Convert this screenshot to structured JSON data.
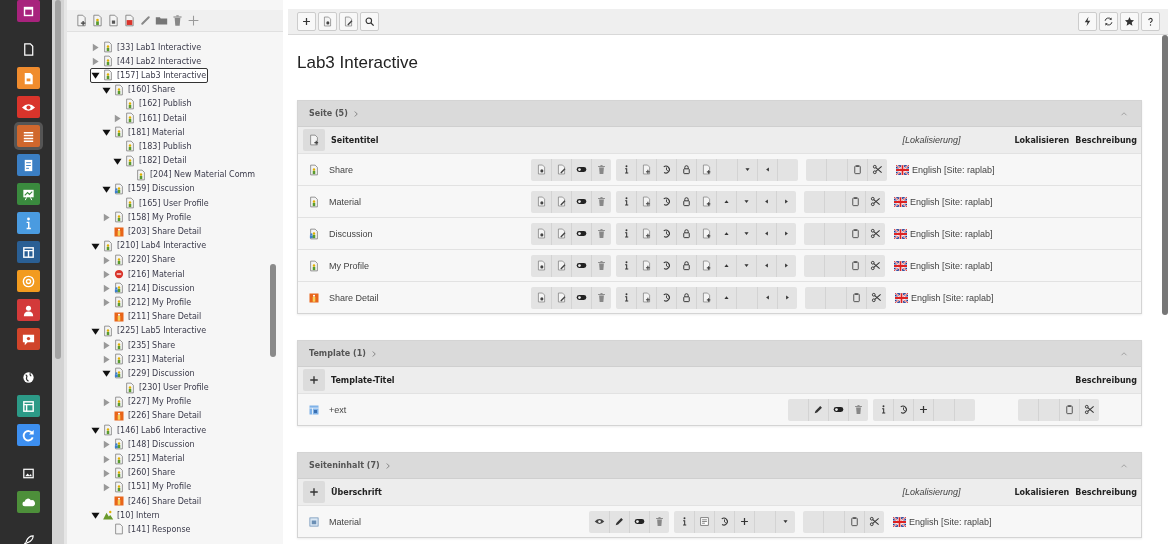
{
  "modules": [
    {
      "kind": "tile",
      "color": "#a8237d",
      "selected": false
    },
    {
      "kind": "plain",
      "selected": false
    },
    {
      "kind": "tile",
      "color": "#f08c2e",
      "selected": false
    },
    {
      "kind": "tile",
      "color": "#d9342b",
      "selected": false
    },
    {
      "kind": "tile",
      "color": "#d0672d",
      "selected": true
    },
    {
      "kind": "tile",
      "color": "#3b7fc4",
      "selected": false
    },
    {
      "kind": "tile",
      "color": "#3a8a3e",
      "selected": false
    },
    {
      "kind": "tile",
      "color": "#4a9be0",
      "selected": false
    },
    {
      "kind": "tile",
      "color": "#2a5f94",
      "selected": false
    },
    {
      "kind": "tile",
      "color": "#f29b1f",
      "selected": false
    },
    {
      "kind": "tile",
      "color": "#d33a3a",
      "selected": false
    },
    {
      "kind": "tile",
      "color": "#d0442a",
      "selected": false
    },
    {
      "kind": "plain",
      "selected": false
    },
    {
      "kind": "tile",
      "color": "#2c9a87",
      "selected": false
    },
    {
      "kind": "tile",
      "color": "#3d8ff0",
      "selected": false
    },
    {
      "kind": "plain",
      "selected": false
    },
    {
      "kind": "tile",
      "color": "#4d8f3a",
      "selected": false
    },
    {
      "kind": "plain",
      "selected": false
    }
  ],
  "tree": {
    "items": [
      {
        "label": "[33] Lab1 Interactive",
        "kind": "page",
        "expanded": false,
        "selected": false
      },
      {
        "label": "[44] Lab2 Interactive",
        "kind": "page",
        "expanded": false,
        "selected": false
      },
      {
        "label": "[157] Lab3 Interactive",
        "kind": "page",
        "expanded": true,
        "selected": true,
        "children": [
          {
            "label": "[160] Share",
            "kind": "page",
            "expanded": true,
            "selected": false,
            "children": [
              {
                "label": "[162] Publish",
                "kind": "page",
                "selected": false
              },
              {
                "label": "[161] Detail",
                "kind": "page",
                "expanded": false,
                "selected": false
              }
            ]
          },
          {
            "label": "[181] Material",
            "kind": "page",
            "expanded": true,
            "selected": false,
            "children": [
              {
                "label": "[183] Publish",
                "kind": "page",
                "selected": false
              },
              {
                "label": "[182] Detail",
                "kind": "page",
                "expanded": true,
                "selected": false,
                "children": [
                  {
                    "label": "[204] New Material Comm",
                    "kind": "page",
                    "selected": false
                  }
                ]
              }
            ]
          },
          {
            "label": "[159] Discussion",
            "kind": "group",
            "expanded": true,
            "selected": false,
            "children": [
              {
                "label": "[165] User Profile",
                "kind": "page",
                "selected": false
              }
            ]
          },
          {
            "label": "[158] My Profile",
            "kind": "page",
            "expanded": false,
            "selected": false
          },
          {
            "label": "[203] Share Detail",
            "kind": "shortcut",
            "selected": false
          }
        ]
      },
      {
        "label": "[210] Lab4 Interactive",
        "kind": "page",
        "expanded": true,
        "selected": false,
        "children": [
          {
            "label": "[220] Share",
            "kind": "page",
            "expanded": false,
            "selected": false
          },
          {
            "label": "[216] Material",
            "kind": "hidden",
            "expanded": false,
            "selected": false
          },
          {
            "label": "[214] Discussion",
            "kind": "group",
            "expanded": false,
            "selected": false
          },
          {
            "label": "[212] My Profile",
            "kind": "page",
            "expanded": false,
            "selected": false
          },
          {
            "label": "[211] Share Detail",
            "kind": "shortcut",
            "selected": false
          }
        ]
      },
      {
        "label": "[225] Lab5 Interactive",
        "kind": "page",
        "expanded": true,
        "selected": false,
        "children": [
          {
            "label": "[235] Share",
            "kind": "page",
            "expanded": false,
            "selected": false
          },
          {
            "label": "[231] Material",
            "kind": "page",
            "expanded": false,
            "selected": false
          },
          {
            "label": "[229] Discussion",
            "kind": "group",
            "expanded": true,
            "selected": false,
            "children": [
              {
                "label": "[230] User Profile",
                "kind": "page",
                "selected": false
              }
            ]
          },
          {
            "label": "[227] My Profile",
            "kind": "page",
            "expanded": false,
            "selected": false
          },
          {
            "label": "[226] Share Detail",
            "kind": "shortcut",
            "selected": false
          }
        ]
      },
      {
        "label": "[146] Lab6 Interactive",
        "kind": "page",
        "expanded": true,
        "selected": false,
        "children": [
          {
            "label": "[148] Discussion",
            "kind": "group",
            "expanded": false,
            "selected": false
          },
          {
            "label": "[251] Material",
            "kind": "page",
            "expanded": false,
            "selected": false
          },
          {
            "label": "[260] Share",
            "kind": "page",
            "expanded": false,
            "selected": false
          },
          {
            "label": "[151] My Profile",
            "kind": "page",
            "expanded": false,
            "selected": false
          },
          {
            "label": "[246] Share Detail",
            "kind": "shortcut",
            "selected": false
          }
        ]
      },
      {
        "label": "[10] Intern",
        "kind": "folder",
        "expanded": true,
        "selected": false,
        "children": [
          {
            "label": "[141] Response",
            "kind": "plain",
            "selected": false
          }
        ]
      }
    ]
  },
  "page_title": "Lab3 Interactive",
  "panels": [
    {
      "title": "Seite (5)",
      "header": {
        "button": {
          "kind": "page-add"
        },
        "title": "Seitentitel",
        "localization": "[Lokalisierung]",
        "localize": "Lokalisieren",
        "description": "Beschreibung"
      },
      "rows": [
        {
          "kind": "page",
          "title": "Share",
          "actions": [
            [
              {
                "kind": "page-view"
              },
              {
                "kind": "page-edit"
              },
              {
                "kind": "toggle"
              },
              {
                "kind": "delete"
              }
            ],
            [
              {
                "kind": "info"
              },
              {
                "kind": "page-new"
              },
              {
                "kind": "history"
              },
              {
                "kind": "lock"
              },
              {
                "kind": "page-add"
              },
              {
                "kind": "blank"
              },
              {
                "kind": "down"
              },
              {
                "kind": "left"
              },
              {
                "kind": "blank"
              }
            ],
            [
              {
                "kind": "blank"
              },
              {
                "kind": "blank"
              },
              {
                "kind": "paste"
              },
              {
                "kind": "cut"
              }
            ]
          ],
          "language": "English [Site: raplab]"
        },
        {
          "kind": "page",
          "title": "Material",
          "actions": [
            [
              {
                "kind": "page-view"
              },
              {
                "kind": "page-edit"
              },
              {
                "kind": "toggle"
              },
              {
                "kind": "delete"
              }
            ],
            [
              {
                "kind": "info"
              },
              {
                "kind": "page-new"
              },
              {
                "kind": "history"
              },
              {
                "kind": "lock"
              },
              {
                "kind": "page-add"
              },
              {
                "kind": "up"
              },
              {
                "kind": "down"
              },
              {
                "kind": "left"
              },
              {
                "kind": "right"
              }
            ],
            [
              {
                "kind": "blank"
              },
              {
                "kind": "blank"
              },
              {
                "kind": "paste"
              },
              {
                "kind": "cut"
              }
            ]
          ],
          "language": "English [Site: raplab]"
        },
        {
          "kind": "group",
          "title": "Discussion",
          "actions": [
            [
              {
                "kind": "page-view"
              },
              {
                "kind": "page-edit"
              },
              {
                "kind": "toggle"
              },
              {
                "kind": "delete"
              }
            ],
            [
              {
                "kind": "info"
              },
              {
                "kind": "page-new"
              },
              {
                "kind": "history"
              },
              {
                "kind": "lock"
              },
              {
                "kind": "page-add"
              },
              {
                "kind": "up"
              },
              {
                "kind": "down"
              },
              {
                "kind": "left"
              },
              {
                "kind": "right"
              }
            ],
            [
              {
                "kind": "blank"
              },
              {
                "kind": "blank"
              },
              {
                "kind": "paste"
              },
              {
                "kind": "cut"
              }
            ]
          ],
          "language": "English [Site: raplab]"
        },
        {
          "kind": "page",
          "title": "My Profile",
          "actions": [
            [
              {
                "kind": "page-view"
              },
              {
                "kind": "page-edit"
              },
              {
                "kind": "toggle"
              },
              {
                "kind": "delete"
              }
            ],
            [
              {
                "kind": "info"
              },
              {
                "kind": "page-new"
              },
              {
                "kind": "history"
              },
              {
                "kind": "lock"
              },
              {
                "kind": "page-add"
              },
              {
                "kind": "up"
              },
              {
                "kind": "down"
              },
              {
                "kind": "left"
              },
              {
                "kind": "right"
              }
            ],
            [
              {
                "kind": "blank"
              },
              {
                "kind": "blank"
              },
              {
                "kind": "paste"
              },
              {
                "kind": "cut"
              }
            ]
          ],
          "language": "English [Site: raplab]"
        },
        {
          "kind": "shortcut",
          "title": "Share Detail",
          "actions": [
            [
              {
                "kind": "page-view"
              },
              {
                "kind": "page-edit"
              },
              {
                "kind": "toggle"
              },
              {
                "kind": "delete"
              }
            ],
            [
              {
                "kind": "info"
              },
              {
                "kind": "page-new"
              },
              {
                "kind": "history"
              },
              {
                "kind": "lock"
              },
              {
                "kind": "page-add"
              },
              {
                "kind": "up"
              },
              {
                "kind": "blank"
              },
              {
                "kind": "left"
              },
              {
                "kind": "right"
              }
            ],
            [
              {
                "kind": "blank"
              },
              {
                "kind": "blank"
              },
              {
                "kind": "paste"
              },
              {
                "kind": "cut"
              }
            ]
          ],
          "language": "English [Site: raplab]"
        }
      ]
    },
    {
      "title": "Template (1)",
      "header": {
        "button": {
          "kind": "plus"
        },
        "title": "Template-Titel",
        "description": "Beschreibung"
      },
      "rows": [
        {
          "kind": "template",
          "title": "+ext",
          "actions": [
            [
              {
                "kind": "blank"
              },
              {
                "kind": "edit"
              },
              {
                "kind": "toggle"
              },
              {
                "kind": "delete"
              }
            ],
            [
              {
                "kind": "info"
              },
              {
                "kind": "history"
              },
              {
                "kind": "plus"
              },
              {
                "kind": "blank"
              },
              {
                "kind": "blank"
              }
            ],
            [
              {
                "kind": "blank"
              },
              {
                "kind": "blank"
              },
              {
                "kind": "paste"
              },
              {
                "kind": "cut"
              }
            ]
          ]
        }
      ]
    },
    {
      "title": "Seiteninhalt (7)",
      "header": {
        "button": {
          "kind": "plus"
        },
        "title": "Überschrift",
        "localization": "[Lokalisierung]",
        "localize": "Lokalisieren",
        "description": "Beschreibung"
      },
      "rows": [
        {
          "kind": "content",
          "title": "Material",
          "actions": [
            [
              {
                "kind": "eye"
              },
              {
                "kind": "edit"
              },
              {
                "kind": "toggle"
              },
              {
                "kind": "delete"
              }
            ],
            [
              {
                "kind": "info"
              },
              {
                "kind": "content"
              },
              {
                "kind": "history"
              },
              {
                "kind": "plus"
              },
              {
                "kind": "blank"
              },
              {
                "kind": "down"
              }
            ],
            [
              {
                "kind": "blank"
              },
              {
                "kind": "blank"
              },
              {
                "kind": "paste"
              },
              {
                "kind": "cut"
              }
            ]
          ],
          "language": "English [Site: raplab]"
        }
      ]
    }
  ]
}
